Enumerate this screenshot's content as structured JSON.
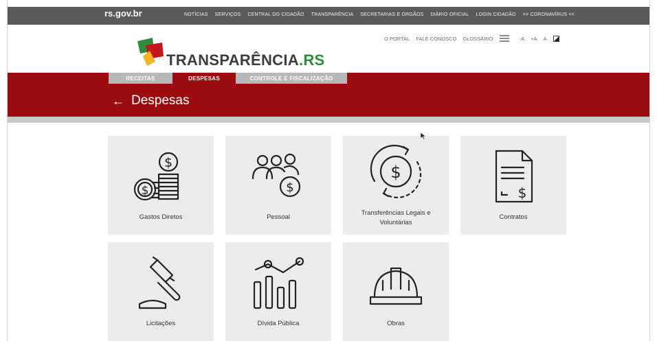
{
  "govbar": {
    "brand": "rs.gov.br",
    "nav": [
      "NOTÍCIAS",
      "SERVIÇOS",
      "CENTRAL DO CIDADÃO",
      "TRANSPARÊNCIA",
      "SECRETARIAS E ÓRGÃOS",
      "DIÁRIO OFICIAL",
      "LOGIN CIDADÃO",
      ">> CORONAVÍRUS <<"
    ]
  },
  "utility": {
    "links": [
      "O PORTAL",
      "FALE CONOSCO",
      "GLOSSÁRIO"
    ],
    "font_sizes": [
      "-A",
      "+A",
      "A"
    ]
  },
  "logo": {
    "prefix": "TRANSPARÊNCIA",
    "suffix": ".RS"
  },
  "tabs": [
    {
      "label": "RECEITAS"
    },
    {
      "label": "DESPESAS",
      "active": true
    },
    {
      "label": "CONTROLE E FISCALIZAÇÃO"
    }
  ],
  "page": {
    "back_icon": "arrow-left-icon",
    "title": "Despesas"
  },
  "cards": [
    {
      "label": "Gastos Diretos",
      "icon": "coins-icon"
    },
    {
      "label": "Pessoal",
      "icon": "people-money-icon"
    },
    {
      "label": "Transferências Legais e Voluntárias",
      "icon": "money-transfer-icon"
    },
    {
      "label": "Contratos",
      "icon": "contract-icon"
    },
    {
      "label": "Licitações",
      "icon": "gavel-icon"
    },
    {
      "label": "Dívida Pública",
      "icon": "chart-icon"
    },
    {
      "label": "Obras",
      "icon": "hardhat-icon"
    }
  ],
  "colors": {
    "gov_bar": "#5a5a5a",
    "brand_red": "#9b0c10",
    "card_bg": "#ececec",
    "logo_green": "#2f8a3c",
    "tab_grey": "#b8b8b8"
  }
}
